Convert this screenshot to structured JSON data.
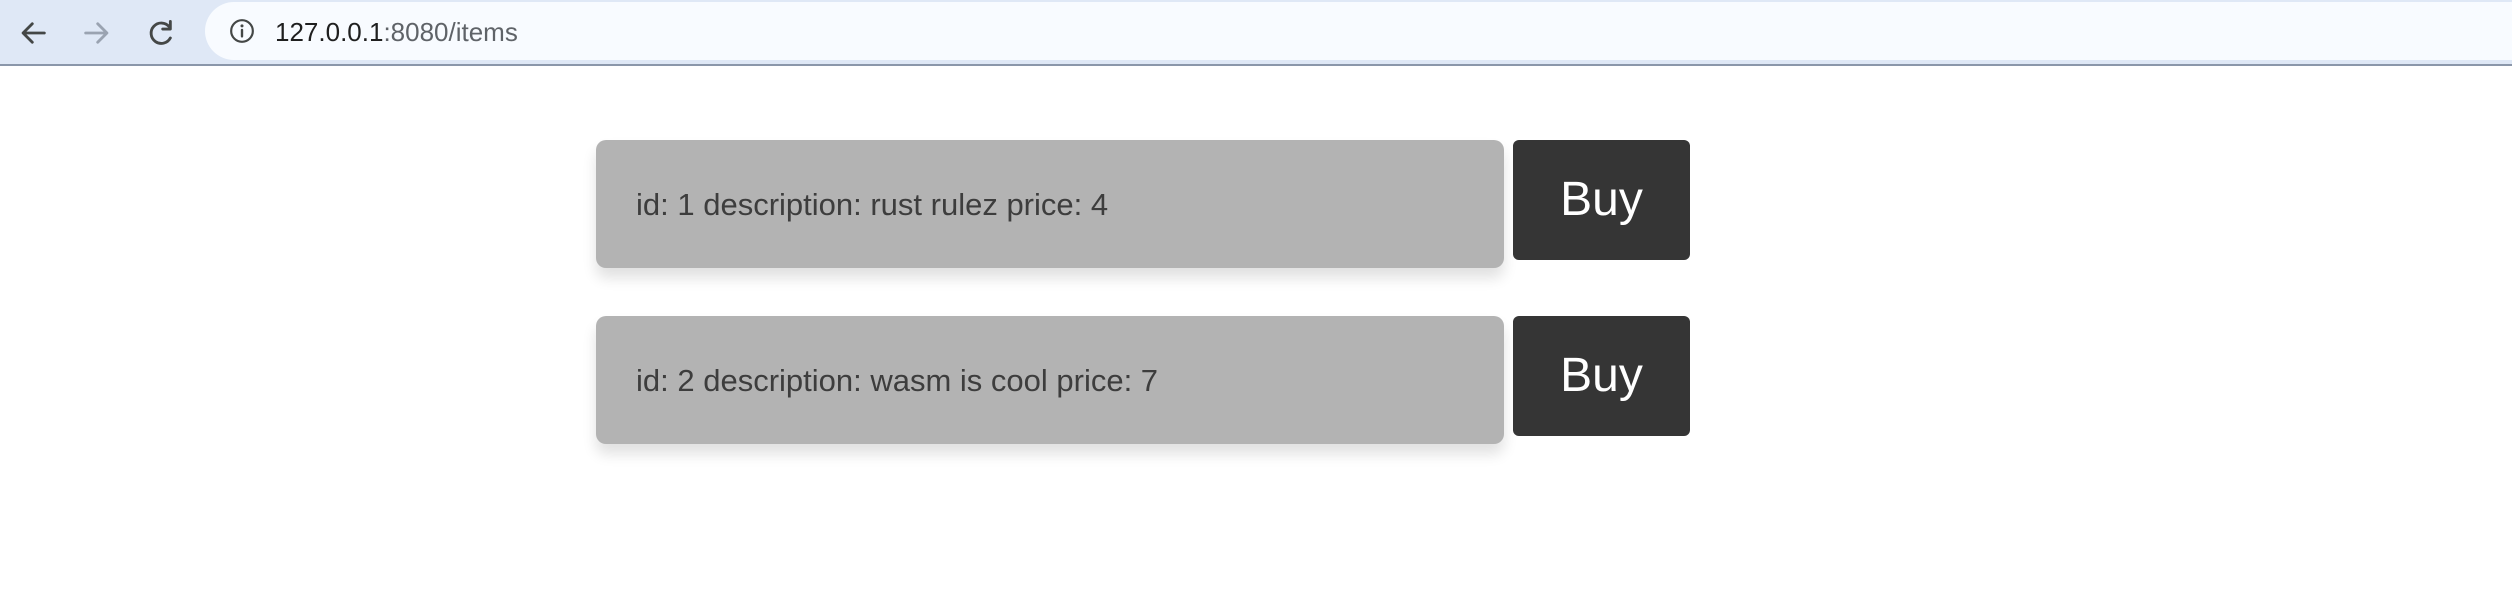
{
  "browser": {
    "back_icon": "arrow-left-icon",
    "forward_icon": "arrow-right-icon",
    "reload_icon": "reload-icon",
    "site_info_icon": "info-circle-icon",
    "url_host": "127.0.0.1",
    "url_path": ":8080/items",
    "colors": {
      "toolbar": "#dfe8f6",
      "address_bar": "#f8fbff",
      "icon_active": "#444746",
      "icon_disabled": "#9aa3b1"
    }
  },
  "items": [
    {
      "text": "id: 1 description: rust rulez price: 4",
      "button_label": "Buy"
    },
    {
      "text": "id: 2 description: wasm is cool price: 7",
      "button_label": "Buy"
    }
  ],
  "colors": {
    "card_background": "#b3b3b3",
    "card_text": "#3d3d3d",
    "button_background": "#353535",
    "button_text": "#ffffff"
  }
}
